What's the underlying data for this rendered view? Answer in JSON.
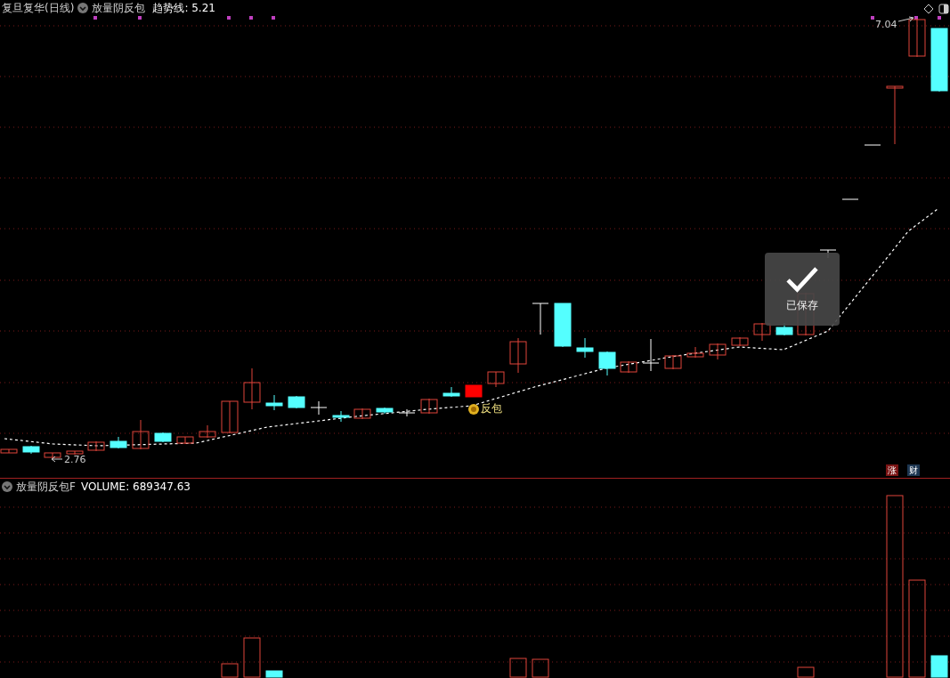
{
  "header": {
    "title": "复旦复华(日线)",
    "indicator": "放量阴反包",
    "trend_label": "趋势线: 5.21"
  },
  "price_chart": {
    "high_label": "7.04",
    "low_label": "2.76",
    "signal_label": "反包",
    "badges": [
      {
        "text": "涨",
        "color": "#7a1414"
      },
      {
        "text": "财",
        "color": "#1c3550"
      }
    ]
  },
  "volume_panel": {
    "indicator": "放量阴反包F",
    "reading": "VOLUME: 689347.63"
  },
  "toast": {
    "text": "已保存"
  }
}
